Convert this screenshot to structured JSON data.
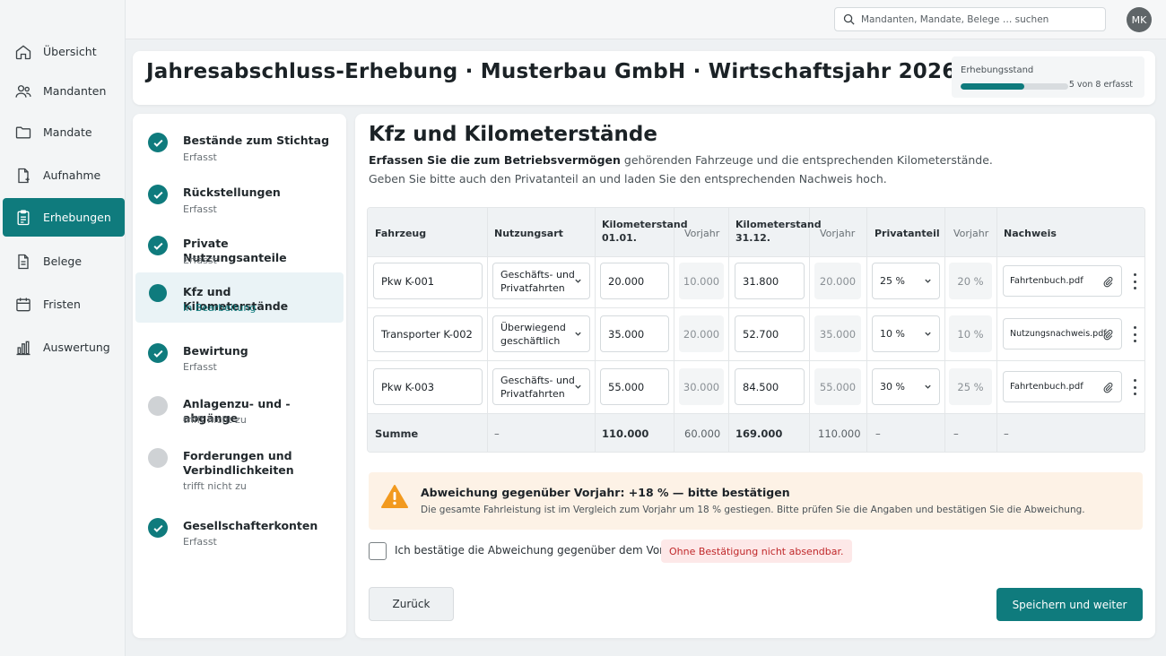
{
  "nav": {
    "items": [
      {
        "label": "Übersicht",
        "icon": "home-icon"
      },
      {
        "label": "Mandanten",
        "icon": "users-icon"
      },
      {
        "label": "Mandate",
        "icon": "folder-icon"
      },
      {
        "label": "Aufnahme",
        "icon": "file-plus-icon"
      },
      {
        "label": "Erhebungen",
        "icon": "clipboard-icon",
        "active": true
      },
      {
        "label": "Belege",
        "icon": "document-icon"
      },
      {
        "label": "Fristen",
        "icon": "calendar-icon"
      },
      {
        "label": "Auswertung",
        "icon": "bar-chart-icon"
      }
    ]
  },
  "topbar": {
    "search_placeholder": "Mandanten, Mandate, Belege … suchen",
    "avatar_initials": "MK"
  },
  "header": {
    "title": "Jahresabschluss-Erhebung · Musterbau GmbH · Wirtschaftsjahr 2026",
    "progress_label": "Erhebungsstand",
    "progress_count": "5 von 8 erfasst",
    "progress_fraction": 0.59
  },
  "steps": [
    {
      "title": "Bestände zum Stichtag",
      "status": "Erfasst",
      "state": "done"
    },
    {
      "title": "Rückstellungen",
      "status": "Erfasst",
      "state": "done"
    },
    {
      "title": "Private Nutzungsanteile",
      "status": "Erfasst",
      "state": "done"
    },
    {
      "title": "Kfz und Kilometerstände",
      "status": "In Bearbeitung",
      "state": "active"
    },
    {
      "title": "Bewirtung",
      "status": "Erfasst",
      "state": "done"
    },
    {
      "title": "Anlagenzu- und -abgänge",
      "status": "trifft nicht zu",
      "state": "na"
    },
    {
      "title": "Forderungen und Verbindlichkeiten",
      "status": "trifft nicht zu",
      "state": "na"
    },
    {
      "title": "Gesellschafterkonten",
      "status": "Erfasst",
      "state": "done"
    }
  ],
  "main": {
    "title": "Kfz und Kilometerstände",
    "desc1_bold": "Erfassen Sie die zum Betriebsvermögen",
    "desc1_rest": " gehörenden Fahrzeuge und die entsprechenden Kilometerstände.",
    "desc2": "Geben Sie bitte auch den Privatanteil an und laden Sie den entsprechenden Nachweis hoch."
  },
  "table": {
    "headers": {
      "vehicle": "Fahrzeug",
      "usage": "Nutzungsart",
      "km_start": [
        "Kilometerstand",
        "01.01."
      ],
      "prev1": "Vorjahr",
      "km_end": [
        "Kilometerstand",
        "31.12."
      ],
      "prev2": "Vorjahr",
      "private": "Privatanteil",
      "prev3": "Vorjahr",
      "proof": "Nachweis"
    },
    "rows": [
      {
        "vehicle": "Pkw K-001",
        "usage": [
          "Geschäfts- und",
          "Privatfahrten"
        ],
        "km_start": "20.000",
        "prev_start": "10.000",
        "km_end": "31.800",
        "prev_end": "20.000",
        "private": "25 %",
        "prev_private": "20 %",
        "proof": "Fahrtenbuch.pdf"
      },
      {
        "vehicle": "Transporter K-002",
        "usage": [
          "Überwiegend",
          "geschäftlich"
        ],
        "km_start": "35.000",
        "prev_start": "20.000",
        "km_end": "52.700",
        "prev_end": "35.000",
        "private": "10 %",
        "prev_private": "10 %",
        "proof": "Nutzungsnachweis.pdf"
      },
      {
        "vehicle": "Pkw K-003",
        "usage": [
          "Geschäfts- und",
          "Privatfahrten"
        ],
        "km_start": "55.000",
        "prev_start": "30.000",
        "km_end": "84.500",
        "prev_end": "55.000",
        "private": "30 %",
        "prev_private": "25 %",
        "proof": "Fahrtenbuch.pdf"
      }
    ],
    "sum": {
      "label": "Summe",
      "usage": "–",
      "km_start": "110.000",
      "prev_start": "60.000",
      "km_end": "169.000",
      "prev_end": "110.000",
      "private": "–",
      "prev_private": "–",
      "proof": "–"
    }
  },
  "alert": {
    "title": "Abweichung gegenüber Vorjahr: +18 % — bitte bestätigen",
    "text": "Die gesamte Fahrleistung ist im Vergleich zum Vorjahr um 18 % gestiegen.  Bitte prüfen Sie die Angaben und bestätigen Sie die Abweichung."
  },
  "confirm": {
    "label": "Ich bestätige die Abweichung gegenüber dem Vorjahr.",
    "badge": "Ohne Bestätigung nicht absendbar.",
    "checked": false
  },
  "buttons": {
    "back": "Zurück",
    "next": "Speichern und weiter"
  },
  "colors": {
    "accent": "#0f7b7d",
    "warning": "#f29a1f",
    "alert_bg": "#fdf2e6",
    "error": "#c0282a"
  }
}
